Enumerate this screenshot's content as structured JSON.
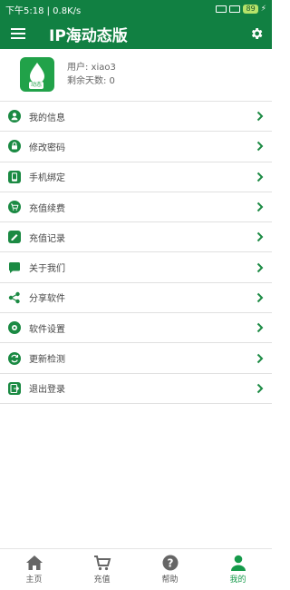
{
  "status_bar": {
    "time_text": "下午5:18 | 0.8K/s",
    "battery": "89"
  },
  "header": {
    "title": "IP海动态版"
  },
  "profile": {
    "logo_tag": "动态",
    "user_label": "用户: xiao3",
    "remaining_label": "剩余天数: 0"
  },
  "menu": [
    {
      "label": "我的信息",
      "icon": "user-icon"
    },
    {
      "label": "修改密码",
      "icon": "lock-icon"
    },
    {
      "label": "手机绑定",
      "icon": "phone-icon"
    },
    {
      "label": "充值续费",
      "icon": "cart-icon"
    },
    {
      "label": "充值记录",
      "icon": "record-icon"
    },
    {
      "label": "关于我们",
      "icon": "chat-icon"
    },
    {
      "label": "分享软件",
      "icon": "share-icon"
    },
    {
      "label": "软件设置",
      "icon": "gear-icon"
    },
    {
      "label": "更新检测",
      "icon": "refresh-icon"
    },
    {
      "label": "退出登录",
      "icon": "logout-icon"
    }
  ],
  "bottom_nav": [
    {
      "label": "主页",
      "icon": "home-icon",
      "active": false
    },
    {
      "label": "充值",
      "icon": "cart-icon",
      "active": false
    },
    {
      "label": "帮助",
      "icon": "help-icon",
      "active": false
    },
    {
      "label": "我的",
      "icon": "user-icon",
      "active": true
    }
  ],
  "colors": {
    "brand": "#118042",
    "accent": "#159a4a"
  }
}
